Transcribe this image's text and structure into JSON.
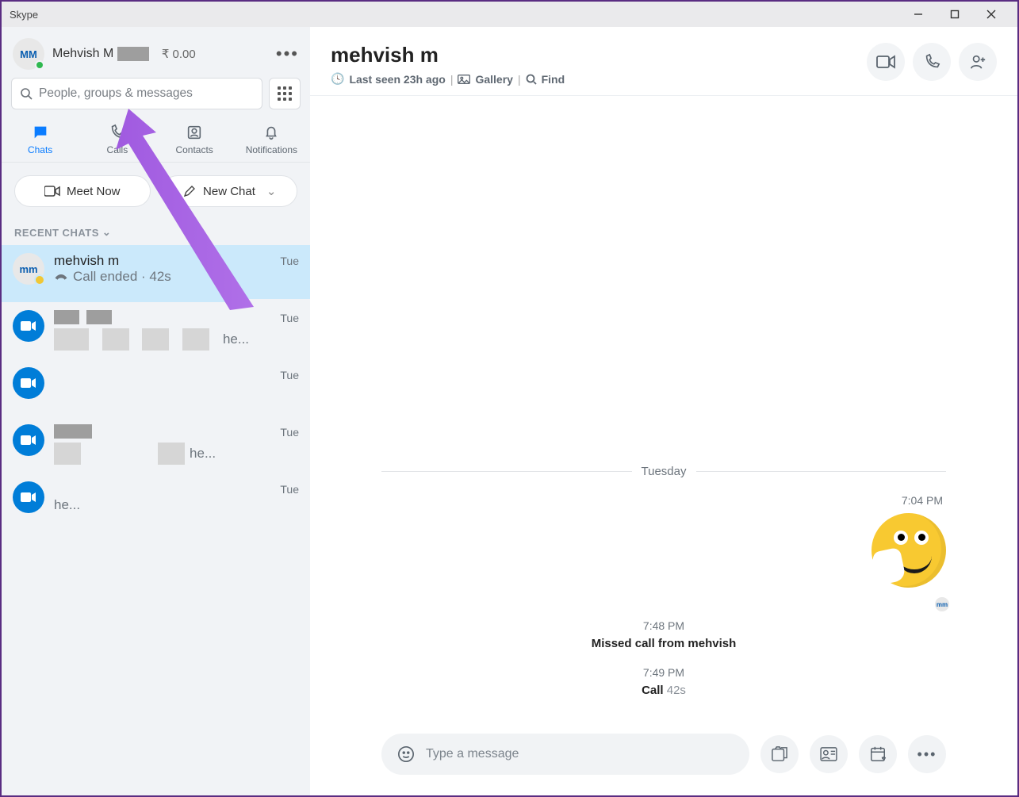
{
  "window": {
    "title": "Skype"
  },
  "me": {
    "initials": "MM",
    "name": "Mehvish M",
    "balance": "₹ 0.00"
  },
  "search": {
    "placeholder": "People, groups & messages"
  },
  "tabs": {
    "chats": "Chats",
    "calls": "Calls",
    "contacts": "Contacts",
    "notifications": "Notifications"
  },
  "buttons": {
    "meet_now": "Meet Now",
    "new_chat": "New Chat"
  },
  "section": {
    "recent": "RECENT CHATS"
  },
  "chats": [
    {
      "name": "mehvish m",
      "sub": "Call ended · 42s",
      "time": "Tue"
    },
    {
      "name": "",
      "sub": "he...",
      "time": "Tue"
    },
    {
      "name": "",
      "sub": "",
      "time": "Tue"
    },
    {
      "name": "",
      "sub": "he...",
      "time": "Tue"
    },
    {
      "name": "",
      "sub": "he...",
      "time": "Tue"
    }
  ],
  "header": {
    "title": "mehvish m",
    "last_seen": "Last seen 23h ago",
    "gallery": "Gallery",
    "find": "Find"
  },
  "conversation": {
    "day": "Tuesday",
    "emoji_time": "7:04 PM",
    "missed": {
      "time": "7:48 PM",
      "text": "Missed call from mehvish"
    },
    "call": {
      "time": "7:49 PM",
      "label": "Call",
      "duration": "42s"
    }
  },
  "composer": {
    "placeholder": "Type a message"
  }
}
